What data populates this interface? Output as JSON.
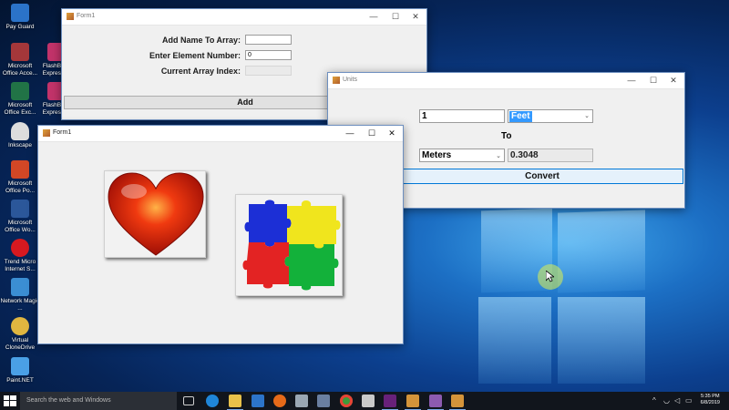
{
  "desktop_icons": [
    {
      "label": "Pay Guard",
      "color": "#2b73c8"
    },
    {
      "label": "Microsoft Office Acce...",
      "color": "#a4373a"
    },
    {
      "label": "Microsoft Office Exc...",
      "color": "#217346"
    },
    {
      "label": "Inkscape",
      "color": "#333333"
    },
    {
      "label": "Microsoft Office Po...",
      "color": "#d24726"
    },
    {
      "label": "Microsoft Office Wo...",
      "color": "#2b579a"
    },
    {
      "label": "Trend Micro Internet S...",
      "color": "#d71920"
    },
    {
      "label": "Network Magic ...",
      "color": "#3b8ed3"
    },
    {
      "label": "Virtual CloneDrive",
      "color": "#e0b640"
    },
    {
      "label": "Paint.NET",
      "color": "#4aa0e6"
    },
    {
      "label": "FlashBack Express ...",
      "color": "#c2336a"
    },
    {
      "label": "FlashBack Express ...",
      "color": "#c2336a"
    }
  ],
  "form_array": {
    "title": "Form1",
    "add_name_label": "Add Name To Array:",
    "add_name_value": "",
    "element_number_label": "Enter Element Number:",
    "element_number_value": "0",
    "current_index_label": "Current Array Index:",
    "current_index_value": "",
    "add_button": "Add"
  },
  "form_units": {
    "title": "Units",
    "input_value": "1",
    "from_unit": "Feet",
    "to_label": "To",
    "to_unit": "Meters",
    "result_value": "0.3048",
    "convert_button": "Convert"
  },
  "form_images": {
    "title": "Form1"
  },
  "window_controls": {
    "minimize": "—",
    "maximize": "☐",
    "close": "✕"
  },
  "taskbar": {
    "search_placeholder": "Search the web and Windows",
    "time": "5:35 PM",
    "date": "6/8/2019"
  },
  "colors": {
    "accent": "#0078d7",
    "taskbar": "#11151c",
    "selection": "#3399ff"
  }
}
